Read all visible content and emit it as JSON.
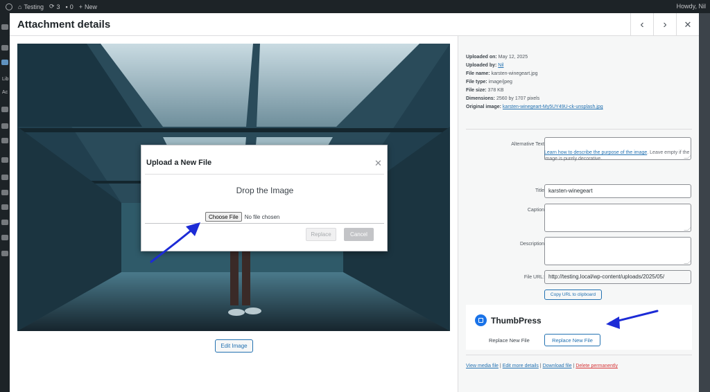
{
  "adminbar": {
    "site_name": "Testing",
    "updates_count": "3",
    "comments_count": "0",
    "new_label": "New",
    "howdy": "Howdy, Nil"
  },
  "sidebar": {
    "lib_label": "Lib",
    "add_label": "Ac"
  },
  "modal": {
    "title": "Attachment details",
    "prev_icon": "chevron-left-icon",
    "next_icon": "chevron-right-icon",
    "close_icon": "close-icon"
  },
  "image_panel": {
    "edit_image_label": "Edit Image"
  },
  "upload_dialog": {
    "title": "Upload a New File",
    "drop_text": "Drop the Image",
    "choose_file_label": "Choose File",
    "no_file_text": "No file chosen",
    "replace_label": "Replace",
    "cancel_label": "Cancel"
  },
  "meta": {
    "uploaded_on_label": "Uploaded on:",
    "uploaded_on": "May 12, 2025",
    "uploaded_by_label": "Uploaded by:",
    "uploaded_by": "Nil",
    "file_name_label": "File name:",
    "file_name": "karsten-winegeart.jpg",
    "file_type_label": "File type:",
    "file_type": "image/jpeg",
    "file_size_label": "File size:",
    "file_size": "378 KB",
    "dimensions_label": "Dimensions:",
    "dimensions": "2560 by 1707 pixels",
    "original_image_label": "Original image:",
    "original_image": "karsten-winegeart-My5UY49U-ck-unsplash.jpg"
  },
  "fields": {
    "alt_text_label": "Alternative Text",
    "alt_text_value": "",
    "alt_help_link": "Learn how to describe the purpose of the image",
    "alt_help_rest": ". Leave empty if the image is purely decorative.",
    "title_label": "Title",
    "title_value": "karsten-winegeart",
    "caption_label": "Caption",
    "caption_value": "",
    "description_label": "Description",
    "description_value": "",
    "file_url_label": "File URL:",
    "file_url_value": "http://testing.local/wp-content/uploads/2025/05/",
    "copy_url_label": "Copy URL to clipboard"
  },
  "thumbpress": {
    "name": "ThumbPress",
    "replace_label": "Replace New File",
    "replace_button": "Replace New File"
  },
  "actions": {
    "view_media": "View media file",
    "edit_more": "Edit more details",
    "download": "Download file",
    "delete": "Delete permanently",
    "separator": "|"
  },
  "colors": {
    "accent": "#2271b1",
    "danger": "#d63638",
    "annotation_arrow": "#1c2bd6"
  }
}
